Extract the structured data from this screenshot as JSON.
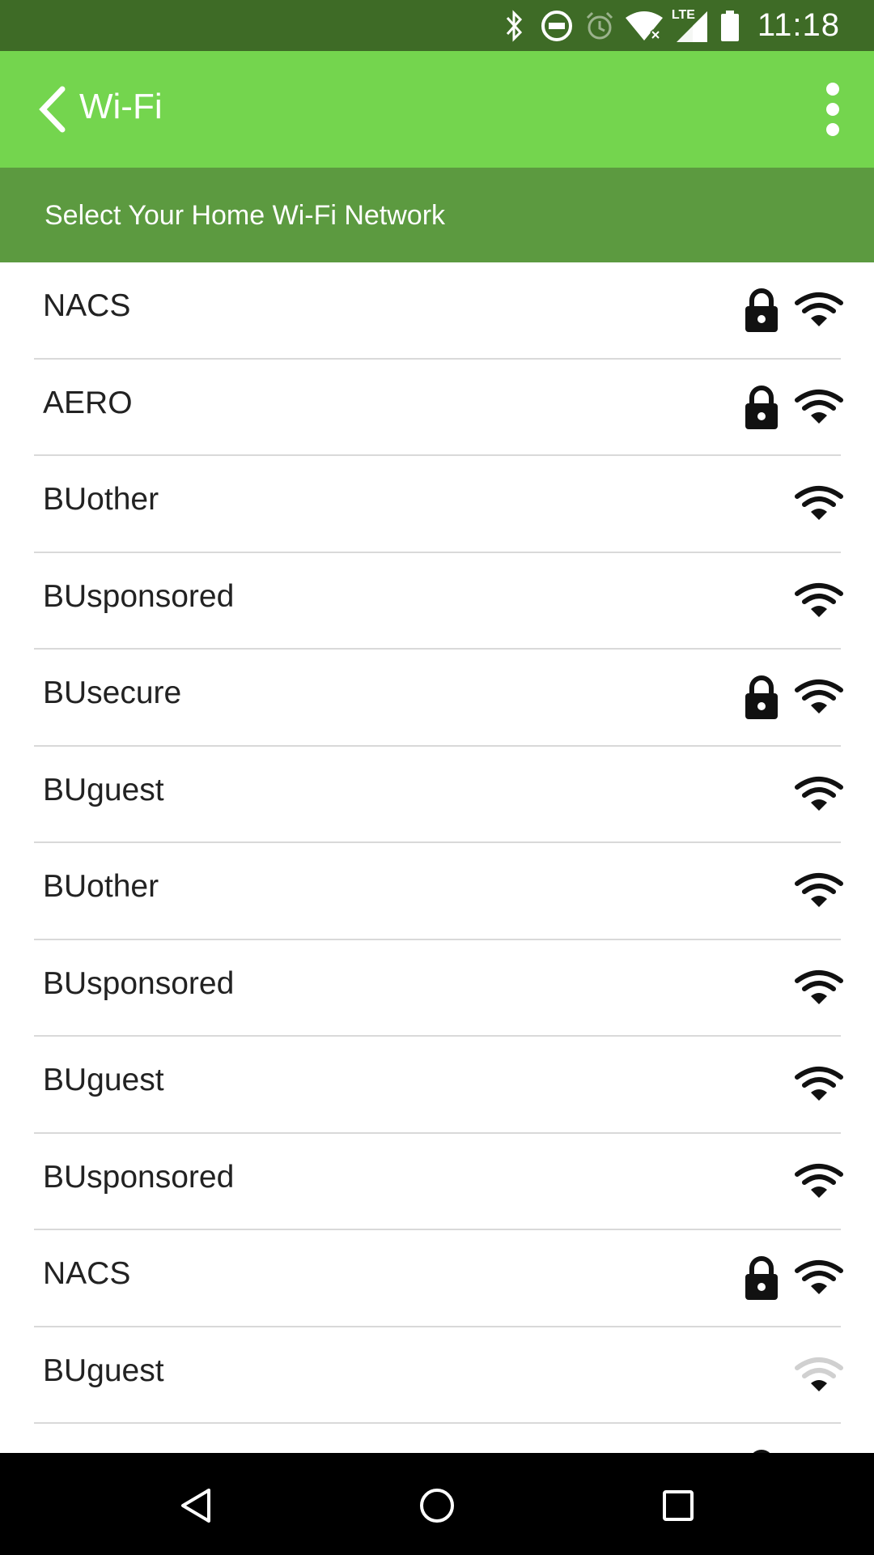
{
  "status_bar": {
    "time": "11:18",
    "icons": [
      "bluetooth-icon",
      "do-not-disturb-icon",
      "alarm-icon",
      "wifi-no-internet-icon",
      "lte-signal-icon",
      "battery-icon"
    ],
    "network_type": "LTE"
  },
  "app_bar": {
    "title": "Wi-Fi",
    "background": "#74d54e"
  },
  "subheader": {
    "text": "Select Your Home Wi-Fi Network",
    "background": "#5c9a40"
  },
  "networks": [
    {
      "ssid": "NACS",
      "secured": true,
      "signal": "full"
    },
    {
      "ssid": "AERO",
      "secured": true,
      "signal": "full"
    },
    {
      "ssid": "BUother",
      "secured": false,
      "signal": "full"
    },
    {
      "ssid": "BUsponsored",
      "secured": false,
      "signal": "full"
    },
    {
      "ssid": "BUsecure",
      "secured": true,
      "signal": "full"
    },
    {
      "ssid": "BUguest",
      "secured": false,
      "signal": "full"
    },
    {
      "ssid": "BUother",
      "secured": false,
      "signal": "full"
    },
    {
      "ssid": "BUsponsored",
      "secured": false,
      "signal": "full"
    },
    {
      "ssid": "BUguest",
      "secured": false,
      "signal": "full"
    },
    {
      "ssid": "BUsponsored",
      "secured": false,
      "signal": "full"
    },
    {
      "ssid": "NACS",
      "secured": true,
      "signal": "full"
    },
    {
      "ssid": "BUguest",
      "secured": false,
      "signal": "weak"
    }
  ],
  "nav_bar": {
    "buttons": [
      "back-nav-icon",
      "home-nav-icon",
      "recents-nav-icon"
    ]
  }
}
